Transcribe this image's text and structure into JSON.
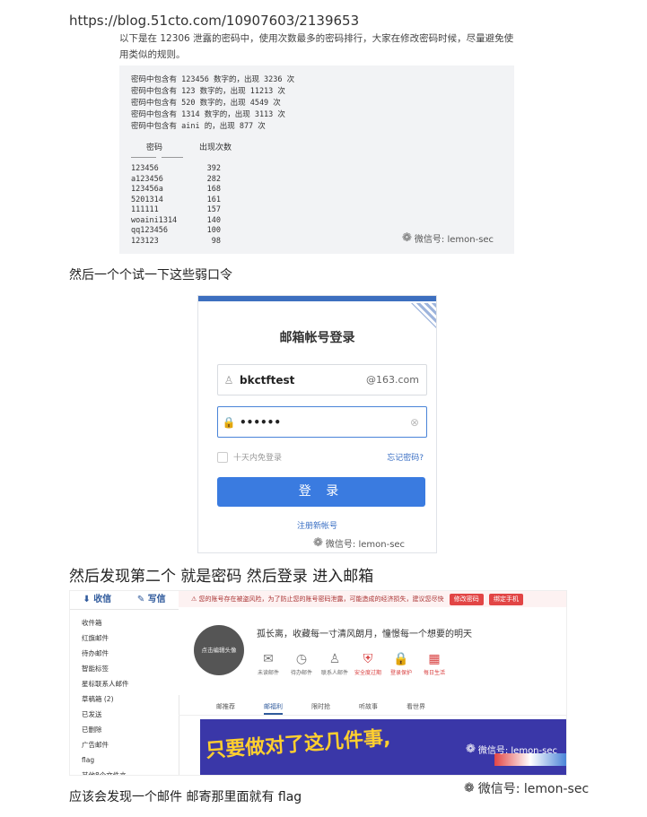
{
  "url": "https://blog.51cto.com/10907603/2139653",
  "intro": "以下是在 12306 泄露的密码中，使用次数最多的密码排行，大家在修改密码时候，尽量避免使用类似的规则。",
  "code_lines": [
    "密码中包含有 123456 数字的，出现 3236 次",
    "密码中包含有 123 数字的，出现 11213 次",
    "密码中包含有 520 数字的，出现 4549 次",
    "密码中包含有 1314 数字的，出现 3113 次",
    "密码中包含有 aini 的，出现 877 次"
  ],
  "table": {
    "col_password": "密码",
    "col_count": "出现次数",
    "rows": [
      {
        "password": "123456",
        "count": "392"
      },
      {
        "password": "a123456",
        "count": "282"
      },
      {
        "password": "123456a",
        "count": "168"
      },
      {
        "password": "5201314",
        "count": "161"
      },
      {
        "password": "111111",
        "count": "157"
      },
      {
        "password": "woaini1314",
        "count": "140"
      },
      {
        "password": "qq123456",
        "count": "100"
      },
      {
        "password": "123123",
        "count": "98"
      }
    ]
  },
  "watermark": "微信号: lemon-sec",
  "caption1": "然后一个个试一下这些弱口令",
  "login": {
    "title": "邮箱帐号登录",
    "username": "bkctftest",
    "domain": "@163.com",
    "password_mask": "••••••",
    "remember": "十天内免登录",
    "forgot": "忘记密码?",
    "button": "登 录",
    "register": "注册新帐号"
  },
  "caption2": "然后发现第二个  就是密码  然后登录  进入邮箱",
  "mail": {
    "receive": "收信",
    "write": "写信",
    "folders": [
      "收件箱",
      "红旗邮件",
      "待办邮件",
      "智能标签",
      "星标联系人邮件",
      "草稿箱 (2)",
      "已发送",
      "已删除",
      "广告邮件",
      "flag",
      "其他8个文件夹"
    ],
    "alert": "您的账号存在被盗风险，为了防止您的账号密码泄露，可能造成的经济损失，建议您尽快",
    "alert_btn1": "修改密码",
    "alert_btn2": "绑定手机",
    "avatar_text": "点击编辑头像",
    "slogan": "孤长离，收藏每一寸清风朗月，憧憬每一个想要的明天",
    "quick": [
      {
        "label": "未读邮件",
        "icon": "✉"
      },
      {
        "label": "待办邮件",
        "icon": "◷"
      },
      {
        "label": "联系人邮件",
        "icon": "♙"
      },
      {
        "label": "安全度过期",
        "icon": "⛨"
      },
      {
        "label": "登录保护",
        "icon": "🔒"
      },
      {
        "label": "每日生活",
        "icon": "▦"
      }
    ],
    "tabs": [
      "邮推荐",
      "邮福利",
      "限时抢",
      "听故事",
      "看世界"
    ],
    "banner_text": "只要做对了这几件事,"
  },
  "caption3": "应该会发现一个邮件  邮寄那里面就有  flag"
}
